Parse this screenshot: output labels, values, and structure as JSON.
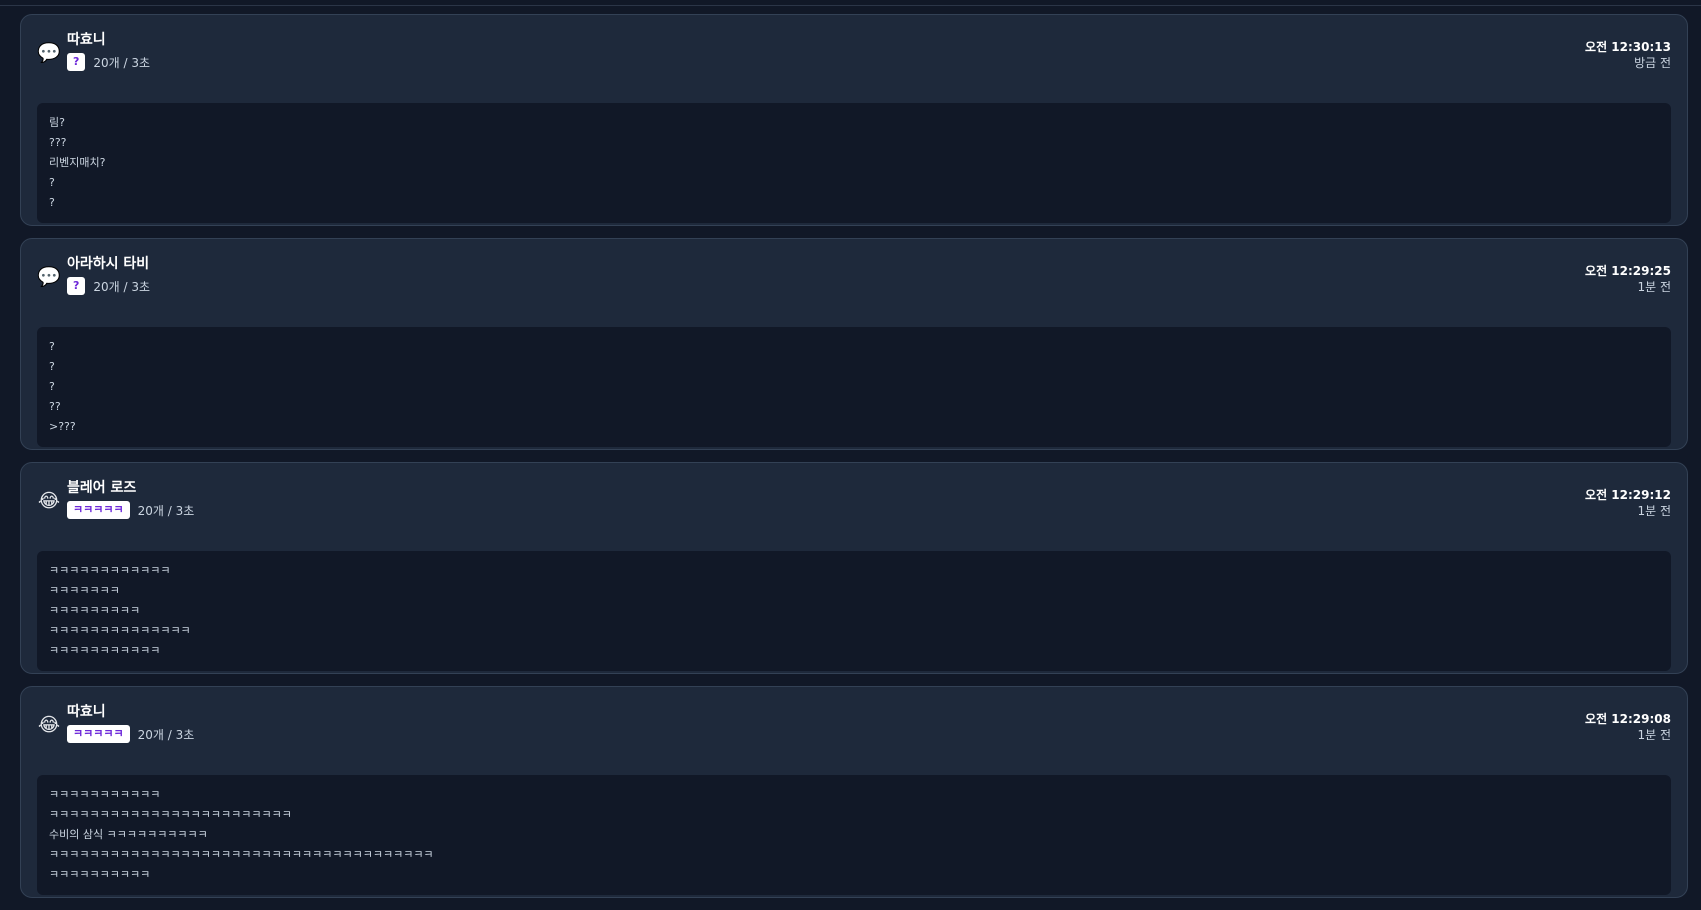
{
  "cards": [
    {
      "emoji": "💬",
      "emoji_name": "speech-bubble-icon",
      "username": "따효니",
      "keyword": "?",
      "count": "20개 / 3초",
      "time": "오전 12:30:13",
      "ago": "방금 전",
      "lines": [
        "림?",
        "???",
        "리벤지매치?",
        "?",
        "?"
      ]
    },
    {
      "emoji": "💬",
      "emoji_name": "speech-bubble-icon",
      "username": "아라하시 타비",
      "keyword": "?",
      "count": "20개 / 3초",
      "time": "오전 12:29:25",
      "ago": "1분 전",
      "lines": [
        "?",
        "?",
        "?",
        "??",
        ">???"
      ]
    },
    {
      "emoji": "😂",
      "emoji_name": "laughing-face-icon",
      "username": "블레어 로즈",
      "keyword": "ㅋㅋㅋㅋㅋ",
      "count": "20개 / 3초",
      "time": "오전 12:29:12",
      "ago": "1분 전",
      "lines": [
        "ㅋㅋㅋㅋㅋㅋㅋㅋㅋㅋㅋㅋ",
        "ㅋㅋㅋㅋㅋㅋㅋ",
        "ㅋㅋㅋㅋㅋㅋㅋㅋㅋ",
        "ㅋㅋㅋㅋㅋㅋㅋㅋㅋㅋㅋㅋㅋㅋ",
        "ㅋㅋㅋㅋㅋㅋㅋㅋㅋㅋㅋ"
      ]
    },
    {
      "emoji": "😂",
      "emoji_name": "laughing-face-icon",
      "username": "따효니",
      "keyword": "ㅋㅋㅋㅋㅋ",
      "count": "20개 / 3초",
      "time": "오전 12:29:08",
      "ago": "1분 전",
      "lines": [
        "ㅋㅋㅋㅋㅋㅋㅋㅋㅋㅋㅋ",
        "ㅋㅋㅋㅋㅋㅋㅋㅋㅋㅋㅋㅋㅋㅋㅋㅋㅋㅋㅋㅋㅋㅋㅋㅋ",
        "수비의 삼식 ㅋㅋㅋㅋㅋㅋㅋㅋㅋㅋ",
        "ㅋㅋㅋㅋㅋㅋㅋㅋㅋㅋㅋㅋㅋㅋㅋㅋㅋㅋㅋㅋㅋㅋㅋㅋㅋㅋㅋㅋㅋㅋㅋㅋㅋㅋㅋㅋㅋㅋ",
        "ㅋㅋㅋㅋㅋㅋㅋㅋㅋㅋ"
      ]
    }
  ]
}
